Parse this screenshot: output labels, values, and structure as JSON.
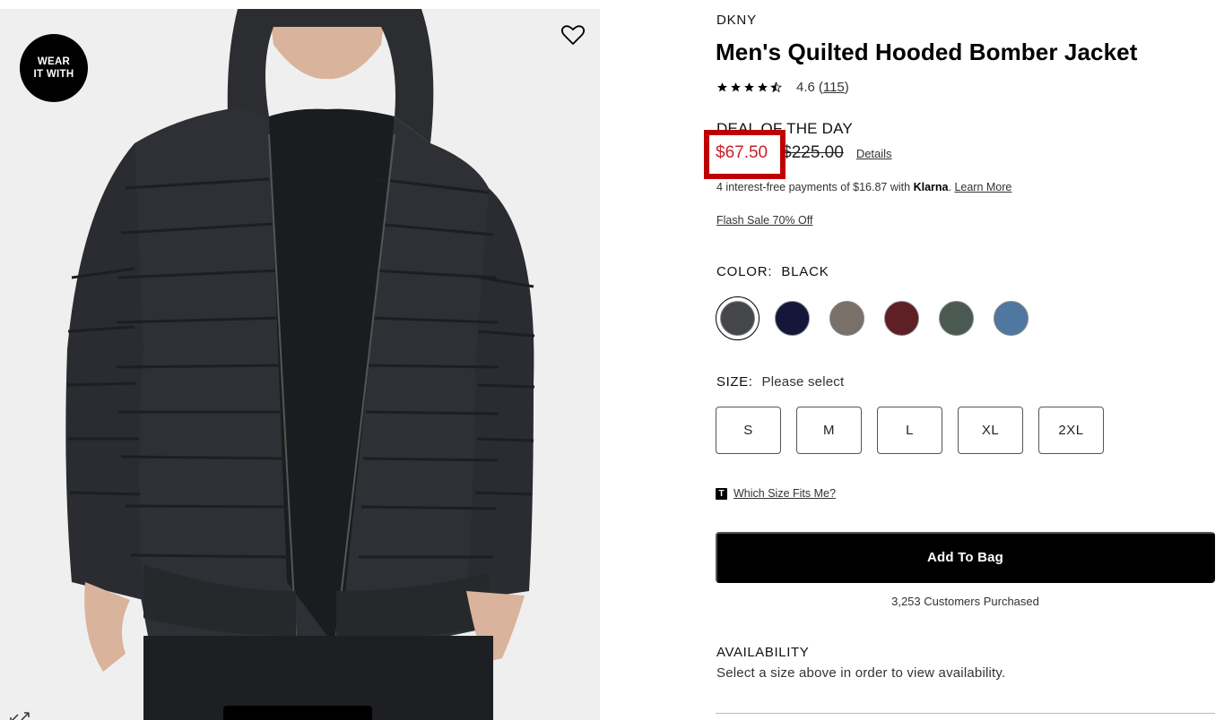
{
  "image_panel": {
    "badge_line1": "WEAR",
    "badge_line2": "IT WITH",
    "heart_icon": "heart-outline-icon",
    "expand_icon": "expand-arrows-icon"
  },
  "product": {
    "brand": "DKNY",
    "title": "Men's Quilted Hooded Bomber Jacket",
    "rating": {
      "stars_value": 4.6,
      "stars_max": 5,
      "score_text": "4.6",
      "open_paren": "(",
      "count": "115",
      "close_paren": ")"
    },
    "deal_label": "DEAL OF THE DAY",
    "sale_price": "$67.50",
    "original_price": "$225.00",
    "details_label": "Details",
    "klarna": {
      "text": "4 interest-free payments of $16.87 with",
      "brand": "Klarna",
      "separator": ".",
      "learn_more": "Learn More"
    },
    "flash_sale": "Flash Sale 70% Off",
    "color": {
      "label": "COLOR:",
      "value": "BLACK",
      "swatches": [
        "#45474a",
        "#14173a",
        "#7a706a",
        "#5e1f25",
        "#4a5a52",
        "#4f77a0"
      ],
      "selected_index": 0
    },
    "size": {
      "label": "SIZE:",
      "value": "Please select",
      "options": [
        "S",
        "M",
        "L",
        "XL",
        "2XL"
      ]
    },
    "fit": {
      "icon_letter": "T",
      "link": "Which Size Fits Me?"
    },
    "add_to_bag": "Add To Bag",
    "purchased": "3,253 Customers Purchased",
    "availability": {
      "title": "AVAILABILITY",
      "text": "Select a size above in order to view availability."
    }
  },
  "colors": {
    "sale_red": "#c8202b",
    "highlight_box": "#c00000",
    "button_black": "#000000"
  }
}
